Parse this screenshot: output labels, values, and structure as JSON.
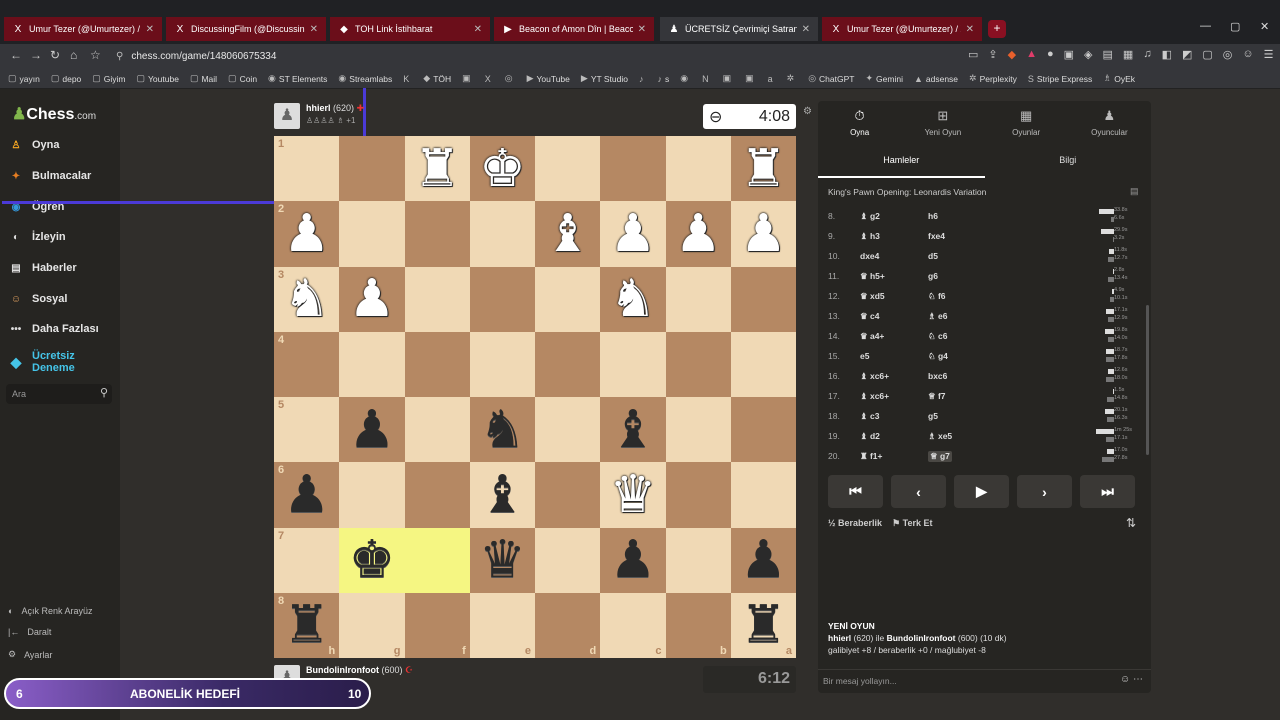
{
  "browser": {
    "tabs": [
      {
        "icon": "X",
        "title": "Umur Tezer (@Umurtezer) / X",
        "style": "red"
      },
      {
        "icon": "X",
        "title": "DiscussingFilm (@DiscussingFilm) / X",
        "style": "red"
      },
      {
        "icon": "◆",
        "title": "TOH Link İstihbarat",
        "style": "red"
      },
      {
        "icon": "▶",
        "title": "Beacon of Amon Dîn | Beacons of Mi",
        "style": "red"
      },
      {
        "icon": "♟",
        "title": "ÜCRETSİZ Çevrimiçi Satranç O",
        "style": "active"
      },
      {
        "icon": "X",
        "title": "Umur Tezer (@Umurtezer) / X",
        "style": "red"
      }
    ],
    "new_tab": "+",
    "url": "chess.com/game/148060675334",
    "bookmarks": [
      {
        "icon": "▢",
        "label": "yayın"
      },
      {
        "icon": "▢",
        "label": "depo"
      },
      {
        "icon": "▢",
        "label": "Giyim"
      },
      {
        "icon": "▢",
        "label": "Youtube"
      },
      {
        "icon": "▢",
        "label": "Mail"
      },
      {
        "icon": "▢",
        "label": "Coin"
      },
      {
        "icon": "◉",
        "label": "ST Elements"
      },
      {
        "icon": "◉",
        "label": "Streamlabs"
      },
      {
        "icon": "K",
        "label": ""
      },
      {
        "icon": "◆",
        "label": "TÖH"
      },
      {
        "icon": "▣",
        "label": ""
      },
      {
        "icon": "X",
        "label": ""
      },
      {
        "icon": "◎",
        "label": ""
      },
      {
        "icon": "▶",
        "label": "YouTube"
      },
      {
        "icon": "▶",
        "label": "YT Studio"
      },
      {
        "icon": "♪",
        "label": ""
      },
      {
        "icon": "♪",
        "label": "s"
      },
      {
        "icon": "◉",
        "label": ""
      },
      {
        "icon": "N",
        "label": ""
      },
      {
        "icon": "▣",
        "label": ""
      },
      {
        "icon": "▣",
        "label": ""
      },
      {
        "icon": "a",
        "label": ""
      },
      {
        "icon": "✲",
        "label": ""
      },
      {
        "icon": "◎",
        "label": "ChatGPT"
      },
      {
        "icon": "✦",
        "label": "Gemini"
      },
      {
        "icon": "▲",
        "label": "adsense"
      },
      {
        "icon": "✲",
        "label": "Perplexity"
      },
      {
        "icon": "S",
        "label": "Stripe Express"
      },
      {
        "icon": "♗",
        "label": "OyEk"
      }
    ]
  },
  "sidebar": {
    "logo_main": "Chess",
    "logo_suffix": ".com",
    "items": [
      {
        "label": "Oyna",
        "icon": "♙",
        "color": "#f5a623"
      },
      {
        "label": "Bulmacalar",
        "icon": "✦",
        "color": "#e67e22"
      },
      {
        "label": "Öğren",
        "icon": "◉",
        "color": "#3498db"
      },
      {
        "label": "İzleyin",
        "icon": "◐",
        "color": "#ddd"
      },
      {
        "label": "Haberler",
        "icon": "▤",
        "color": "#ddd"
      },
      {
        "label": "Sosyal",
        "icon": "☺",
        "color": "#e0a060"
      },
      {
        "label": "Daha Fazlası",
        "icon": "•••",
        "color": "#ddd"
      }
    ],
    "premium_line1": "Ücretsiz",
    "premium_line2": "Deneme",
    "search_placeholder": "Ara",
    "bottom": [
      {
        "label": "Açık Renk Arayüz",
        "icon": "◐"
      },
      {
        "label": "Daralt",
        "icon": "|←"
      },
      {
        "label": "Ayarlar",
        "icon": "⚙"
      }
    ]
  },
  "top_player": {
    "name": "hhierl",
    "rating": "(620)",
    "flag": "✚",
    "captured": "♙♙♙♙ ♗ +1"
  },
  "bottom_player": {
    "name": "BundolinIronfoot",
    "rating": "(600)",
    "flag": "☪",
    "captured": "♟♟♟ ♝"
  },
  "top_clock": "4:08",
  "bottom_clock": "6:12",
  "board": {
    "ranks": [
      "1",
      "2",
      "3",
      "4",
      "5",
      "6",
      "7",
      "8"
    ],
    "files": [
      "h",
      "g",
      "f",
      "e",
      "d",
      "c",
      "b",
      "a"
    ],
    "squares": [
      [
        "",
        "",
        "♜w",
        "♚w",
        "",
        "",
        "",
        "♜w"
      ],
      [
        "♟w",
        "",
        "",
        "",
        "♝w",
        "♟w",
        "♟w",
        "♟w"
      ],
      [
        "♞w",
        "♟w",
        "",
        "",
        "",
        "♞w",
        "",
        ""
      ],
      [
        "",
        "",
        "",
        "",
        "",
        "",
        "",
        ""
      ],
      [
        "",
        "♟b",
        "",
        "♞b",
        "",
        "♝b",
        "",
        ""
      ],
      [
        "♟b",
        "",
        "",
        "♝b",
        "",
        "♛w",
        "",
        ""
      ],
      [
        "",
        "♚b",
        "",
        "♛b",
        "",
        "♟b",
        "",
        "♟b"
      ],
      [
        "♜b",
        "",
        "",
        "",
        "",
        "",
        "",
        "♜b"
      ]
    ]
  },
  "panel": {
    "tabs": [
      {
        "label": "Oyna",
        "icon": "⏱"
      },
      {
        "label": "Yeni Oyun",
        "icon": "⊞"
      },
      {
        "label": "Oyunlar",
        "icon": "▦"
      },
      {
        "label": "Oyuncular",
        "icon": "♟"
      }
    ],
    "subtabs": [
      "Hamleler",
      "Bilgi"
    ],
    "opening": "King's Pawn Opening: Leonardis Variation",
    "moves": [
      {
        "n": "8.",
        "w": "♝ g2",
        "b": "h6",
        "wt": 33.8,
        "bt": 6.6,
        "wl": "33.8s",
        "bl": "6.6s"
      },
      {
        "n": "9.",
        "w": "♝ h3",
        "b": "fxe4",
        "wt": 29.9,
        "bt": 3.2,
        "wl": "29.9s",
        "bl": "3.2s"
      },
      {
        "n": "10.",
        "w": "dxe4",
        "b": "d5",
        "wt": 11.8,
        "bt": 12.7,
        "wl": "11.8s",
        "bl": "12.7s"
      },
      {
        "n": "11.",
        "w": "♛ h5+",
        "b": "g6",
        "wt": 2.8,
        "bt": 13.4,
        "wl": "2.8s",
        "bl": "13.4s"
      },
      {
        "n": "12.",
        "w": "♛ xd5",
        "b": "♘ f6",
        "wt": 4.9,
        "bt": 10.1,
        "wl": "4.9s",
        "bl": "10.1s"
      },
      {
        "n": "13.",
        "w": "♛ c4",
        "b": "♗ e6",
        "wt": 17.1,
        "bt": 12.9,
        "wl": "17.1s",
        "bl": "12.9s"
      },
      {
        "n": "14.",
        "w": "♛ a4+",
        "b": "♘ c6",
        "wt": 19.8,
        "bt": 14.0,
        "wl": "19.8s",
        "bl": "14.0s"
      },
      {
        "n": "15.",
        "w": "e5",
        "b": "♘ g4",
        "wt": 18.7,
        "bt": 17.8,
        "wl": "18.7s",
        "bl": "17.8s"
      },
      {
        "n": "16.",
        "w": "♝ xc6+",
        "b": "bxc6",
        "wt": 12.6,
        "bt": 18.0,
        "wl": "12.6s",
        "bl": "18.0s"
      },
      {
        "n": "17.",
        "w": "♝ xc6+",
        "b": "♕ f7",
        "wt": 1.5,
        "bt": 14.8,
        "wl": "1.5s",
        "bl": "14.8s"
      },
      {
        "n": "18.",
        "w": "♝ c3",
        "b": "g5",
        "wt": 20.1,
        "bt": 16.3,
        "wl": "20.1s",
        "bl": "16.3s"
      },
      {
        "n": "19.",
        "w": "♝ d2",
        "b": "♗ xe5",
        "wt": 85,
        "bt": 17.1,
        "wl": "1m 25s",
        "bl": "17.1s"
      },
      {
        "n": "20.",
        "w": "♜ f1+",
        "b": "♕ g7",
        "wt": 17.0,
        "bt": 27.8,
        "wl": "17.0s",
        "bl": "27.8s"
      }
    ],
    "controls": [
      "⏮",
      "‹",
      "▶",
      "›",
      "⏭"
    ],
    "draw_label": "Beraberlik",
    "resign_label": "Terk Et",
    "new_game_title": "YENİ OYUN",
    "new_game_line1_a": "hhierl",
    "new_game_line1_b": " (620) ile ",
    "new_game_line1_c": "BundolinIronfoot",
    "new_game_line1_d": " (600) (10 dk)",
    "new_game_line2": "galibiyet +8 / beraberlik +0 / mağlubiyet -8",
    "chat_placeholder": "Bir mesaj yollayın..."
  },
  "subscription_goal": {
    "current": "6",
    "label": "ABONELİK HEDEFİ",
    "target": "10"
  }
}
